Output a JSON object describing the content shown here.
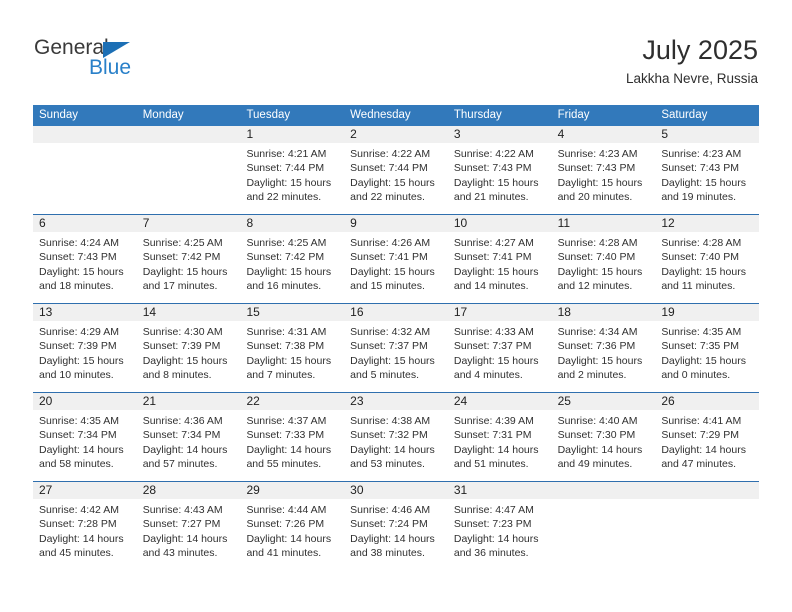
{
  "brand": {
    "name_top": "General",
    "name_bottom": "Blue",
    "triangle_icon": "triangle-icon",
    "color_dark": "#3a3a3a",
    "color_blue": "#2980c9"
  },
  "header": {
    "title": "July 2025",
    "subtitle": "Lakkha Nevre, Russia"
  },
  "theme": {
    "header_bg": "#3279bb",
    "header_text": "#ffffff",
    "daynum_bg": "#f0f0f0",
    "week_divider": "#2f6fae",
    "body_text": "#303030"
  },
  "weekday_headers": [
    "Sunday",
    "Monday",
    "Tuesday",
    "Wednesday",
    "Thursday",
    "Friday",
    "Saturday"
  ],
  "weeks": [
    {
      "days": [
        {
          "day": "",
          "lines": [
            "",
            "",
            "",
            ""
          ]
        },
        {
          "day": "",
          "lines": [
            "",
            "",
            "",
            ""
          ]
        },
        {
          "day": "1",
          "lines": [
            "Sunrise: 4:21 AM",
            "Sunset: 7:44 PM",
            "Daylight: 15 hours",
            "and 22 minutes."
          ]
        },
        {
          "day": "2",
          "lines": [
            "Sunrise: 4:22 AM",
            "Sunset: 7:44 PM",
            "Daylight: 15 hours",
            "and 22 minutes."
          ]
        },
        {
          "day": "3",
          "lines": [
            "Sunrise: 4:22 AM",
            "Sunset: 7:43 PM",
            "Daylight: 15 hours",
            "and 21 minutes."
          ]
        },
        {
          "day": "4",
          "lines": [
            "Sunrise: 4:23 AM",
            "Sunset: 7:43 PM",
            "Daylight: 15 hours",
            "and 20 minutes."
          ]
        },
        {
          "day": "5",
          "lines": [
            "Sunrise: 4:23 AM",
            "Sunset: 7:43 PM",
            "Daylight: 15 hours",
            "and 19 minutes."
          ]
        }
      ]
    },
    {
      "days": [
        {
          "day": "6",
          "lines": [
            "Sunrise: 4:24 AM",
            "Sunset: 7:43 PM",
            "Daylight: 15 hours",
            "and 18 minutes."
          ]
        },
        {
          "day": "7",
          "lines": [
            "Sunrise: 4:25 AM",
            "Sunset: 7:42 PM",
            "Daylight: 15 hours",
            "and 17 minutes."
          ]
        },
        {
          "day": "8",
          "lines": [
            "Sunrise: 4:25 AM",
            "Sunset: 7:42 PM",
            "Daylight: 15 hours",
            "and 16 minutes."
          ]
        },
        {
          "day": "9",
          "lines": [
            "Sunrise: 4:26 AM",
            "Sunset: 7:41 PM",
            "Daylight: 15 hours",
            "and 15 minutes."
          ]
        },
        {
          "day": "10",
          "lines": [
            "Sunrise: 4:27 AM",
            "Sunset: 7:41 PM",
            "Daylight: 15 hours",
            "and 14 minutes."
          ]
        },
        {
          "day": "11",
          "lines": [
            "Sunrise: 4:28 AM",
            "Sunset: 7:40 PM",
            "Daylight: 15 hours",
            "and 12 minutes."
          ]
        },
        {
          "day": "12",
          "lines": [
            "Sunrise: 4:28 AM",
            "Sunset: 7:40 PM",
            "Daylight: 15 hours",
            "and 11 minutes."
          ]
        }
      ]
    },
    {
      "days": [
        {
          "day": "13",
          "lines": [
            "Sunrise: 4:29 AM",
            "Sunset: 7:39 PM",
            "Daylight: 15 hours",
            "and 10 minutes."
          ]
        },
        {
          "day": "14",
          "lines": [
            "Sunrise: 4:30 AM",
            "Sunset: 7:39 PM",
            "Daylight: 15 hours",
            "and 8 minutes."
          ]
        },
        {
          "day": "15",
          "lines": [
            "Sunrise: 4:31 AM",
            "Sunset: 7:38 PM",
            "Daylight: 15 hours",
            "and 7 minutes."
          ]
        },
        {
          "day": "16",
          "lines": [
            "Sunrise: 4:32 AM",
            "Sunset: 7:37 PM",
            "Daylight: 15 hours",
            "and 5 minutes."
          ]
        },
        {
          "day": "17",
          "lines": [
            "Sunrise: 4:33 AM",
            "Sunset: 7:37 PM",
            "Daylight: 15 hours",
            "and 4 minutes."
          ]
        },
        {
          "day": "18",
          "lines": [
            "Sunrise: 4:34 AM",
            "Sunset: 7:36 PM",
            "Daylight: 15 hours",
            "and 2 minutes."
          ]
        },
        {
          "day": "19",
          "lines": [
            "Sunrise: 4:35 AM",
            "Sunset: 7:35 PM",
            "Daylight: 15 hours",
            "and 0 minutes."
          ]
        }
      ]
    },
    {
      "days": [
        {
          "day": "20",
          "lines": [
            "Sunrise: 4:35 AM",
            "Sunset: 7:34 PM",
            "Daylight: 14 hours",
            "and 58 minutes."
          ]
        },
        {
          "day": "21",
          "lines": [
            "Sunrise: 4:36 AM",
            "Sunset: 7:34 PM",
            "Daylight: 14 hours",
            "and 57 minutes."
          ]
        },
        {
          "day": "22",
          "lines": [
            "Sunrise: 4:37 AM",
            "Sunset: 7:33 PM",
            "Daylight: 14 hours",
            "and 55 minutes."
          ]
        },
        {
          "day": "23",
          "lines": [
            "Sunrise: 4:38 AM",
            "Sunset: 7:32 PM",
            "Daylight: 14 hours",
            "and 53 minutes."
          ]
        },
        {
          "day": "24",
          "lines": [
            "Sunrise: 4:39 AM",
            "Sunset: 7:31 PM",
            "Daylight: 14 hours",
            "and 51 minutes."
          ]
        },
        {
          "day": "25",
          "lines": [
            "Sunrise: 4:40 AM",
            "Sunset: 7:30 PM",
            "Daylight: 14 hours",
            "and 49 minutes."
          ]
        },
        {
          "day": "26",
          "lines": [
            "Sunrise: 4:41 AM",
            "Sunset: 7:29 PM",
            "Daylight: 14 hours",
            "and 47 minutes."
          ]
        }
      ]
    },
    {
      "days": [
        {
          "day": "27",
          "lines": [
            "Sunrise: 4:42 AM",
            "Sunset: 7:28 PM",
            "Daylight: 14 hours",
            "and 45 minutes."
          ]
        },
        {
          "day": "28",
          "lines": [
            "Sunrise: 4:43 AM",
            "Sunset: 7:27 PM",
            "Daylight: 14 hours",
            "and 43 minutes."
          ]
        },
        {
          "day": "29",
          "lines": [
            "Sunrise: 4:44 AM",
            "Sunset: 7:26 PM",
            "Daylight: 14 hours",
            "and 41 minutes."
          ]
        },
        {
          "day": "30",
          "lines": [
            "Sunrise: 4:46 AM",
            "Sunset: 7:24 PM",
            "Daylight: 14 hours",
            "and 38 minutes."
          ]
        },
        {
          "day": "31",
          "lines": [
            "Sunrise: 4:47 AM",
            "Sunset: 7:23 PM",
            "Daylight: 14 hours",
            "and 36 minutes."
          ]
        },
        {
          "day": "",
          "lines": [
            "",
            "",
            "",
            ""
          ]
        },
        {
          "day": "",
          "lines": [
            "",
            "",
            "",
            ""
          ]
        }
      ]
    }
  ]
}
